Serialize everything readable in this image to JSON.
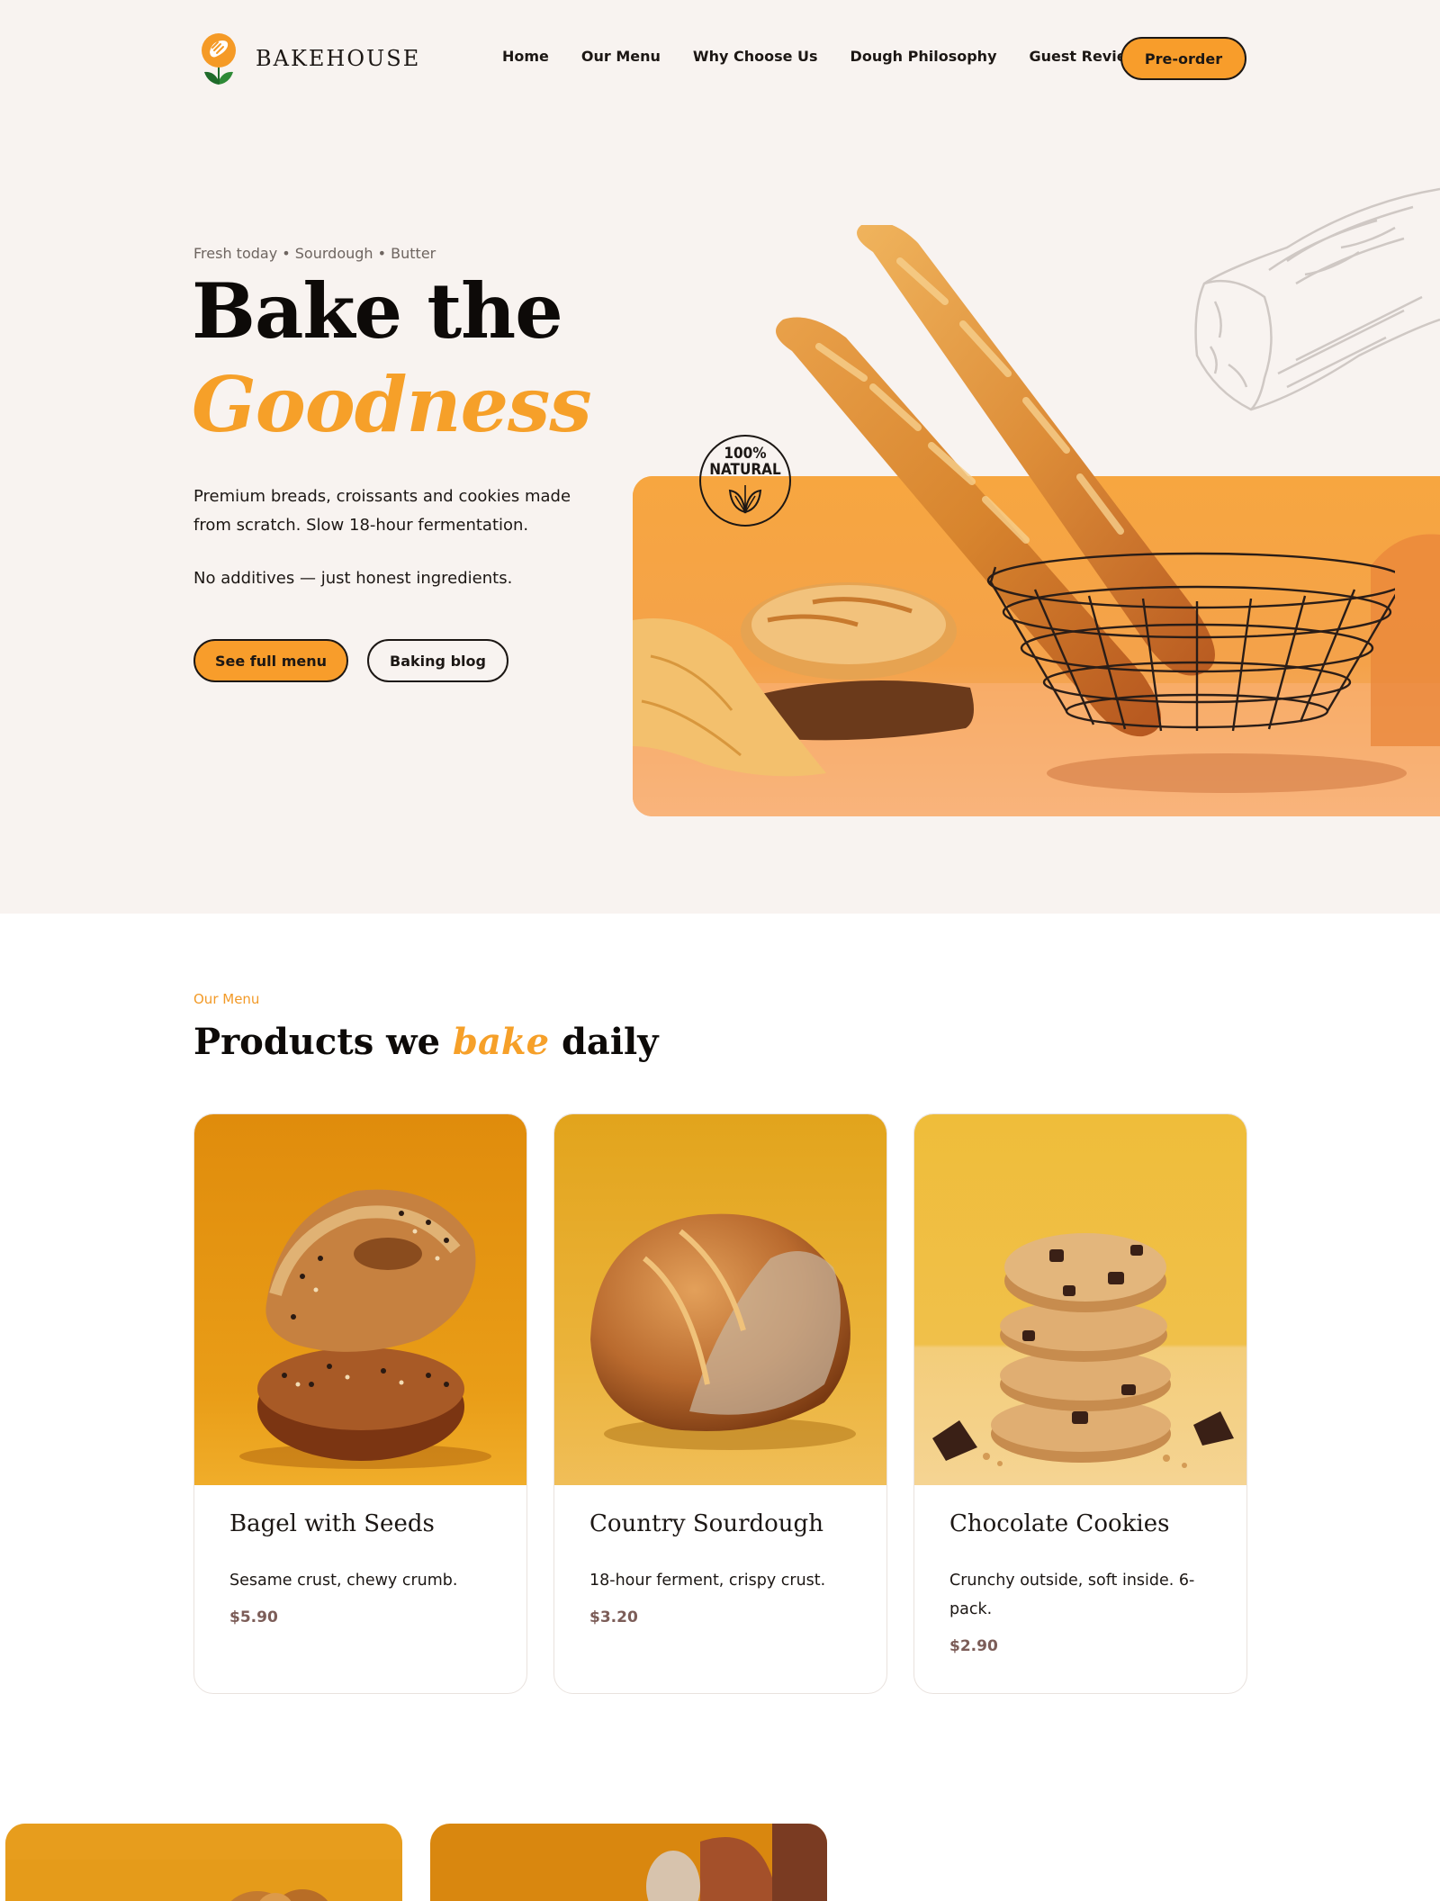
{
  "brand": {
    "name": "BAKEHOUSE"
  },
  "nav": {
    "items": [
      {
        "label": "Home"
      },
      {
        "label": "Our Menu"
      },
      {
        "label": "Why Choose Us"
      },
      {
        "label": "Dough Philosophy"
      },
      {
        "label": "Guest Reviews"
      }
    ],
    "cta_label": "Pre-order"
  },
  "hero": {
    "eyebrow": "Fresh today • Sourdough • Butter",
    "title_line1": "Bake the",
    "title_line2": "Goodness",
    "description": "Premium breads, croissants and cookies made from scratch. Slow 18-hour fermentation.",
    "note": "No additives — just honest ingredients.",
    "primary_button": "See full menu",
    "secondary_button": "Baking blog",
    "badge_line1": "100%",
    "badge_line2": "NATURAL"
  },
  "menu": {
    "label": "Our Menu",
    "title_before": "Products we ",
    "title_accent": "bake",
    "title_after": " daily",
    "products": [
      {
        "name": "Bagel with Seeds",
        "description": "Sesame crust, chewy crumb.",
        "price": "$5.90"
      },
      {
        "name": "Country Sourdough",
        "description": "18-hour ferment, crispy crust.",
        "price": "$3.20"
      },
      {
        "name": "Chocolate Cookies",
        "description": "Crunchy outside, soft inside. 6-pack.",
        "price": "$2.90"
      }
    ]
  },
  "colors": {
    "accent": "#f89d2b",
    "text": "#1c1714",
    "hero_background": "#f8f3f0",
    "price": "#7c5d58"
  }
}
